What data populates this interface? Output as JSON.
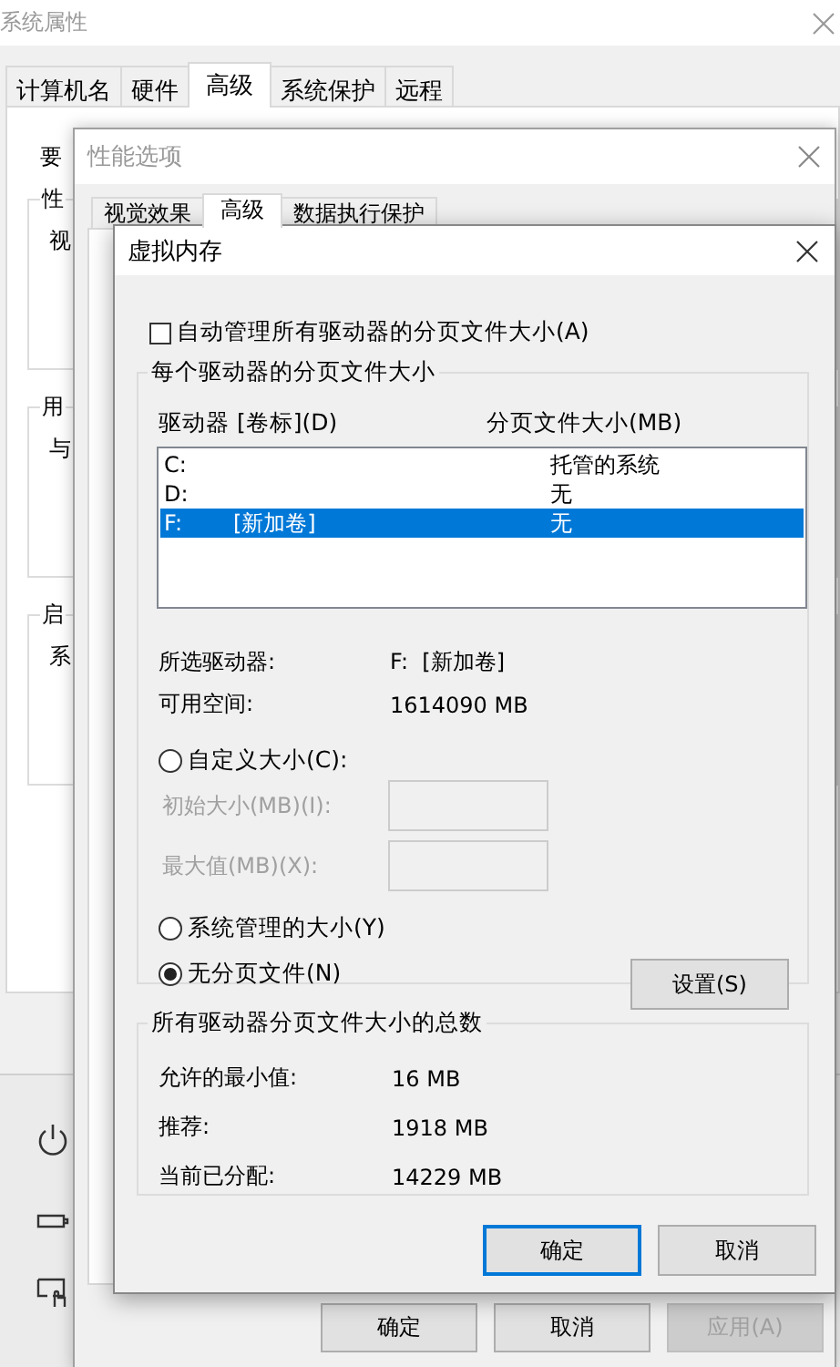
{
  "system_properties": {
    "title": "系统属性",
    "tabs": [
      {
        "label": "计算机名",
        "selected": false
      },
      {
        "label": "硬件",
        "selected": false
      },
      {
        "label": "高级",
        "selected": true
      },
      {
        "label": "系统保护",
        "selected": false
      },
      {
        "label": "远程",
        "selected": false
      }
    ],
    "intro": "要",
    "groups": [
      {
        "title": "性",
        "text": "视"
      },
      {
        "title": "用",
        "text": "与"
      },
      {
        "title": "启",
        "text": "系"
      }
    ]
  },
  "performance_options": {
    "title": "性能选项",
    "tabs": [
      {
        "label": "视觉效果",
        "selected": false
      },
      {
        "label": "高级",
        "selected": true
      },
      {
        "label": "数据执行保护",
        "selected": false
      }
    ],
    "buttons": [
      {
        "label": "确定",
        "disabled": false
      },
      {
        "label": "取消",
        "disabled": false
      },
      {
        "label": "应用(A)",
        "disabled": true
      }
    ]
  },
  "virtual_memory": {
    "title": "虚拟内存",
    "auto_manage": {
      "label": "自动管理所有驱动器的分页文件大小(A)",
      "checked": false
    },
    "per_drive": {
      "title": "每个驱动器的分页文件大小",
      "columns": [
        "驱动器 [卷标](D)",
        "分页文件大小(MB)"
      ],
      "drives": [
        {
          "drive": "C:",
          "size": "托管的系统",
          "selected": false
        },
        {
          "drive": "D:",
          "size": "无",
          "selected": false
        },
        {
          "drive": "F:",
          "volume": "[新加卷]",
          "size": "无",
          "selected": true
        }
      ],
      "selected_drive_label": "所选驱动器:",
      "selected_drive_value": "F:  [新加卷]",
      "free_space_label": "可用空间:",
      "free_space_value": "1614090 MB",
      "options": [
        {
          "label": "自定义大小(C):",
          "selected": false
        },
        {
          "label": "系统管理的大小(Y)",
          "selected": false
        },
        {
          "label": "无分页文件(N)",
          "selected": true
        }
      ],
      "fields": [
        {
          "label": "初始大小(MB)(I):",
          "disabled": true
        },
        {
          "label": "最大值(MB)(X):",
          "disabled": true
        }
      ],
      "set_button": "设置(S)"
    },
    "totals": {
      "title": "所有驱动器分页文件大小的总数",
      "rows": [
        {
          "label": "允许的最小值:",
          "value": "16 MB"
        },
        {
          "label": "推荐:",
          "value": "1918 MB"
        },
        {
          "label": "当前已分配:",
          "value": "14229 MB"
        }
      ]
    },
    "buttons": [
      {
        "label": "确定",
        "focused": true
      },
      {
        "label": "取消",
        "focused": false
      }
    ]
  }
}
